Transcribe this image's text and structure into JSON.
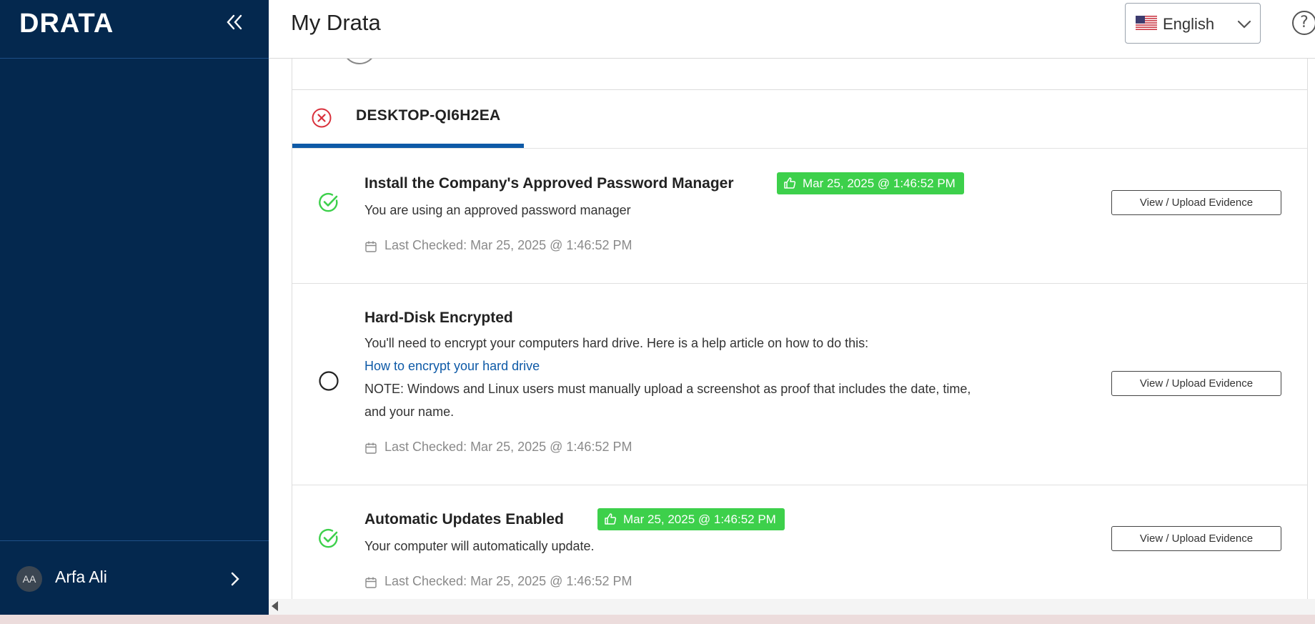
{
  "sidebar": {
    "logo": "DRATA",
    "collapse_icon": "double-chevron-left-icon",
    "user": {
      "initials": "AA",
      "name": "Arfa Ali"
    }
  },
  "header": {
    "title": "My Drata",
    "language": {
      "selected": "English",
      "flag": "us-flag-icon"
    },
    "help_icon": "help-circle-icon"
  },
  "device": {
    "name": "DESKTOP-QI6H2EA",
    "status": "failed",
    "status_color": "#d9303b"
  },
  "checks": [
    {
      "title": "Install the Company's Approved Password Manager",
      "status": "passed",
      "badge": "Mar 25, 2025 @ 1:46:52 PM",
      "lines": [
        "You are using an approved password manager"
      ],
      "last_checked": "Last Checked: Mar 25, 2025 @ 1:46:52 PM",
      "button": "View / Upload Evidence"
    },
    {
      "title": "Hard-Disk Encrypted",
      "status": "pending",
      "badge": "",
      "lines": [
        "You'll need to encrypt your computers hard drive. Here is a help article on how to do this:",
        "NOTE: Windows and Linux users must manually upload a screenshot as proof that includes the date, time,",
        "and your name."
      ],
      "link": "How to encrypt your hard drive",
      "last_checked": "Last Checked: Mar 25, 2025 @ 1:46:52 PM",
      "button": "View / Upload Evidence"
    },
    {
      "title": "Automatic Updates Enabled",
      "status": "passed",
      "badge": "Mar 25, 2025 @ 1:46:52 PM",
      "lines": [
        "Your computer will automatically update."
      ],
      "last_checked": "Last Checked: Mar 25, 2025 @ 1:46:52 PM",
      "button": "View / Upload Evidence"
    }
  ],
  "colors": {
    "sidebar": "#04284e",
    "accent": "#0e5aa7",
    "pass": "#3dd04b",
    "fail": "#d9303b"
  }
}
